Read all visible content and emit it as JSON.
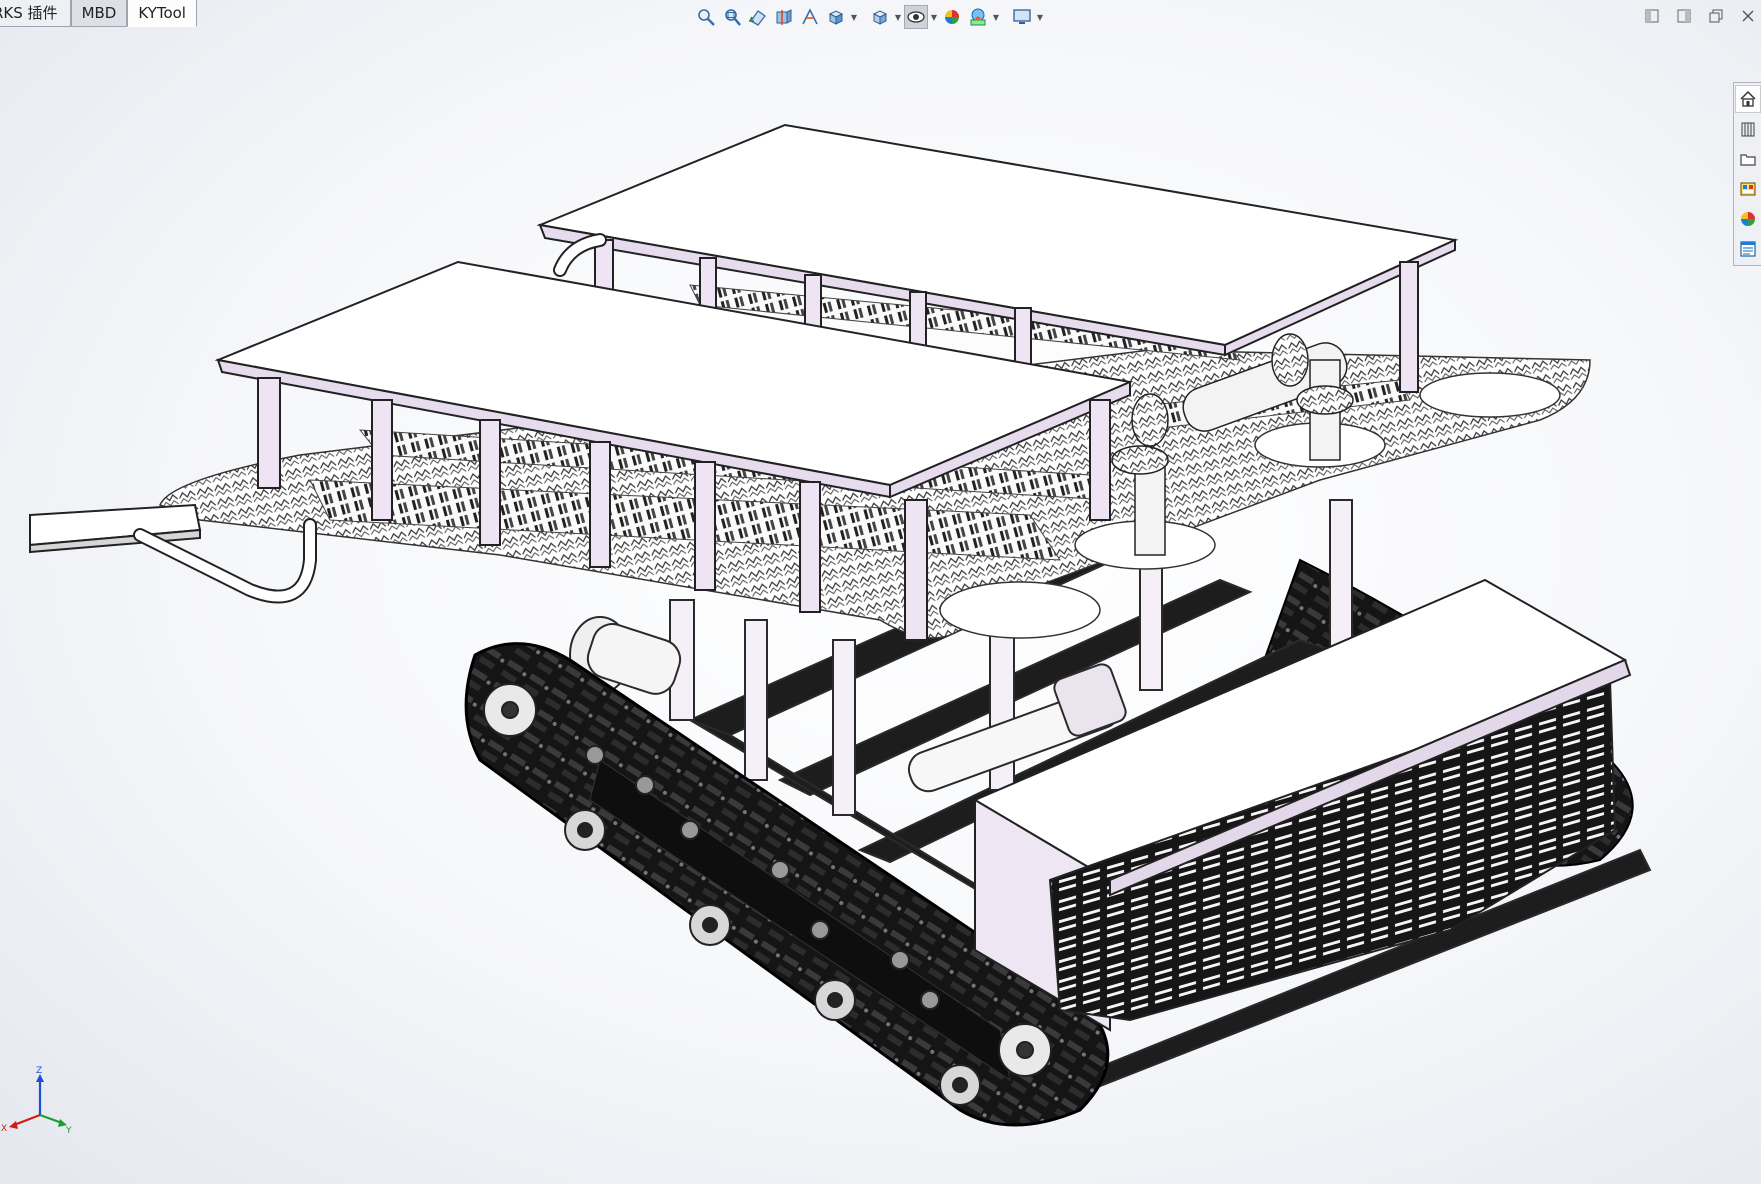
{
  "tabs": [
    {
      "label": "RKS 插件"
    },
    {
      "label": "MBD"
    },
    {
      "label": "KYTool"
    }
  ],
  "toolbar": {
    "icons": [
      "zoom-to-fit-icon",
      "zoom-area-icon",
      "previous-view-icon",
      "section-view-icon",
      "dynamic-annotation-icon",
      "view-orientation-icon",
      "display-style-icon",
      "hide-show-items-icon",
      "edit-appearance-icon",
      "apply-scene-icon",
      "view-settings-icon"
    ]
  },
  "window_controls": [
    "tile-left-icon",
    "tile-right-icon",
    "restore-window-icon",
    "close-window-icon"
  ],
  "task_pane": {
    "icons": [
      "home-icon",
      "design-library-icon",
      "file-explorer-icon",
      "view-palette-icon",
      "appearances-icon",
      "custom-properties-icon"
    ]
  },
  "triad": {
    "x_label": "X",
    "y_label": "Y",
    "z_label": "Z"
  },
  "colors": {
    "frame_fill": "#ffffff",
    "frame_side": "#e9ddf0",
    "frame_stroke": "#2a2a2a",
    "track": "#1c1c1c",
    "background": "#f4f5f8"
  }
}
